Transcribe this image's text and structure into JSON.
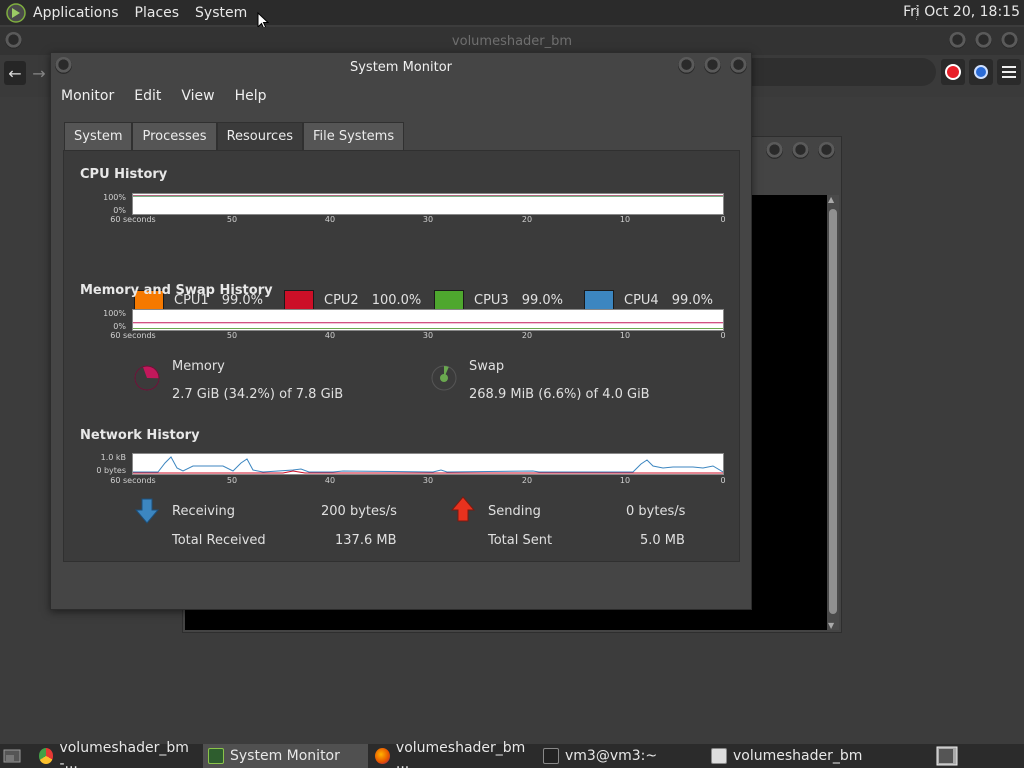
{
  "top_panel": {
    "menus": [
      "Applications",
      "Places",
      "System"
    ],
    "clock": "Fri Oct 20, 18:15"
  },
  "bg_window": {
    "title": "volumeshader_bm"
  },
  "sysmon": {
    "title": "System Monitor",
    "menus": [
      "Monitor",
      "Edit",
      "View",
      "Help"
    ],
    "tabs": [
      "System",
      "Processes",
      "Resources",
      "File Systems"
    ],
    "active_tab": "Resources",
    "cpu": {
      "title": "CPU History",
      "y_labels": [
        "100%",
        "0%"
      ],
      "x_labels": [
        "60 seconds",
        "50",
        "40",
        "30",
        "20",
        "10",
        "0"
      ],
      "legend": [
        {
          "name": "CPU1",
          "value": "99.0%",
          "color": "#f57900"
        },
        {
          "name": "CPU2",
          "value": "100.0%",
          "color": "#cc0f27"
        },
        {
          "name": "CPU3",
          "value": "99.0%",
          "color": "#4ea72e"
        },
        {
          "name": "CPU4",
          "value": "99.0%",
          "color": "#3c86c0"
        }
      ]
    },
    "memory": {
      "title": "Memory and Swap History",
      "y_labels": [
        "100%",
        "0%"
      ],
      "x_labels": [
        "60 seconds",
        "50",
        "40",
        "30",
        "20",
        "10",
        "0"
      ],
      "mem_label": "Memory",
      "mem_value": "2.7 GiB (34.2%) of 7.8 GiB",
      "mem_fraction": 0.342,
      "mem_color": "#c2185b",
      "swap_label": "Swap",
      "swap_value": "268.9 MiB (6.6%) of 4.0 GiB",
      "swap_fraction": 0.066,
      "swap_color": "#6aa84f"
    },
    "network": {
      "title": "Network History",
      "y_labels": [
        "1.0 kB",
        "0 bytes"
      ],
      "x_labels": [
        "60 seconds",
        "50",
        "40",
        "30",
        "20",
        "10",
        "0"
      ],
      "receiving_label": "Receiving",
      "receiving_value": "200 bytes/s",
      "total_received_label": "Total Received",
      "total_received_value": "137.6 MB",
      "sending_label": "Sending",
      "sending_value": "0 bytes/s",
      "total_sent_label": "Total Sent",
      "total_sent_value": "5.0 MB"
    }
  },
  "taskbar": {
    "items": [
      {
        "label": "volumeshader_bm -...",
        "icon": "chrome-icon"
      },
      {
        "label": "System Monitor",
        "icon": "system-monitor-icon"
      },
      {
        "label": "volumeshader_bm ...",
        "icon": "firefox-icon"
      },
      {
        "label": "vm3@vm3:~",
        "icon": "terminal-icon"
      },
      {
        "label": "volumeshader_bm",
        "icon": "window-icon"
      }
    ]
  }
}
